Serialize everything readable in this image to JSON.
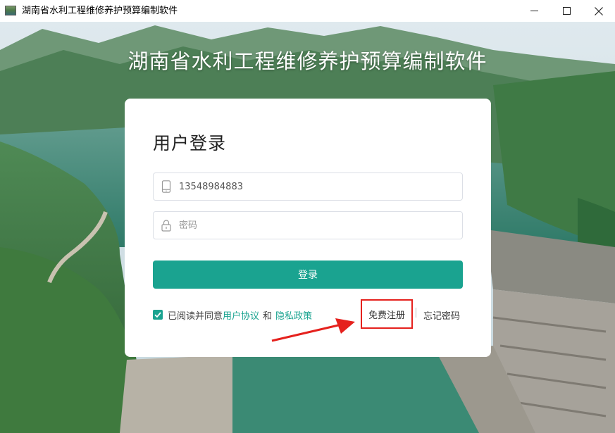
{
  "window": {
    "title": "湖南省水利工程维修养护预算编制软件"
  },
  "hero": {
    "title": "湖南省水利工程维修养护预算编制软件"
  },
  "login": {
    "heading": "用户登录",
    "phone_value": "13548984883",
    "password_placeholder": "密码",
    "submit_label": "登录",
    "agreement": {
      "checked": true,
      "prefix": "已阅读并同意",
      "user_agreement": "用户协议",
      "and": "和",
      "privacy_policy": "隐私政策"
    },
    "register_label": "免费注册",
    "forgot_label": "忘记密码"
  },
  "colors": {
    "accent": "#1aa390",
    "highlight_box": "#e5211d",
    "arrow": "#e5211d"
  }
}
